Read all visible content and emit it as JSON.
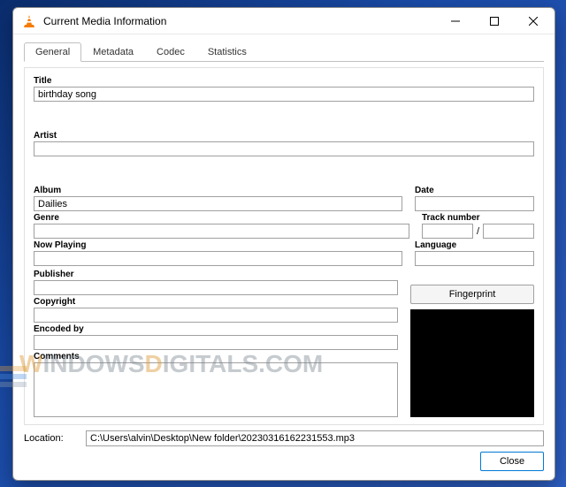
{
  "window": {
    "title": "Current Media Information"
  },
  "tabs": {
    "general": "General",
    "metadata": "Metadata",
    "codec": "Codec",
    "statistics": "Statistics"
  },
  "labels": {
    "title": "Title",
    "artist": "Artist",
    "album": "Album",
    "date": "Date",
    "genre": "Genre",
    "tracknum": "Track number",
    "nowplaying": "Now Playing",
    "language": "Language",
    "publisher": "Publisher",
    "copyright": "Copyright",
    "encodedby": "Encoded by",
    "comments": "Comments",
    "location": "Location:",
    "slash": "/"
  },
  "values": {
    "title": "birthday song",
    "artist": "",
    "album": "Dailies",
    "date": "",
    "genre": "",
    "track_a": "",
    "track_b": "",
    "nowplaying": "",
    "language": "",
    "publisher": "",
    "copyright": "",
    "encodedby": "",
    "comments": "",
    "location": "C:\\Users\\alvin\\Desktop\\New folder\\20230316162231553.mp3"
  },
  "buttons": {
    "fingerprint": "Fingerprint",
    "close": "Close"
  },
  "watermark": {
    "part1": "W",
    "part2": "INDOWS",
    "part3": "D",
    "part4": "IGITALS",
    "part5": ".COM"
  }
}
